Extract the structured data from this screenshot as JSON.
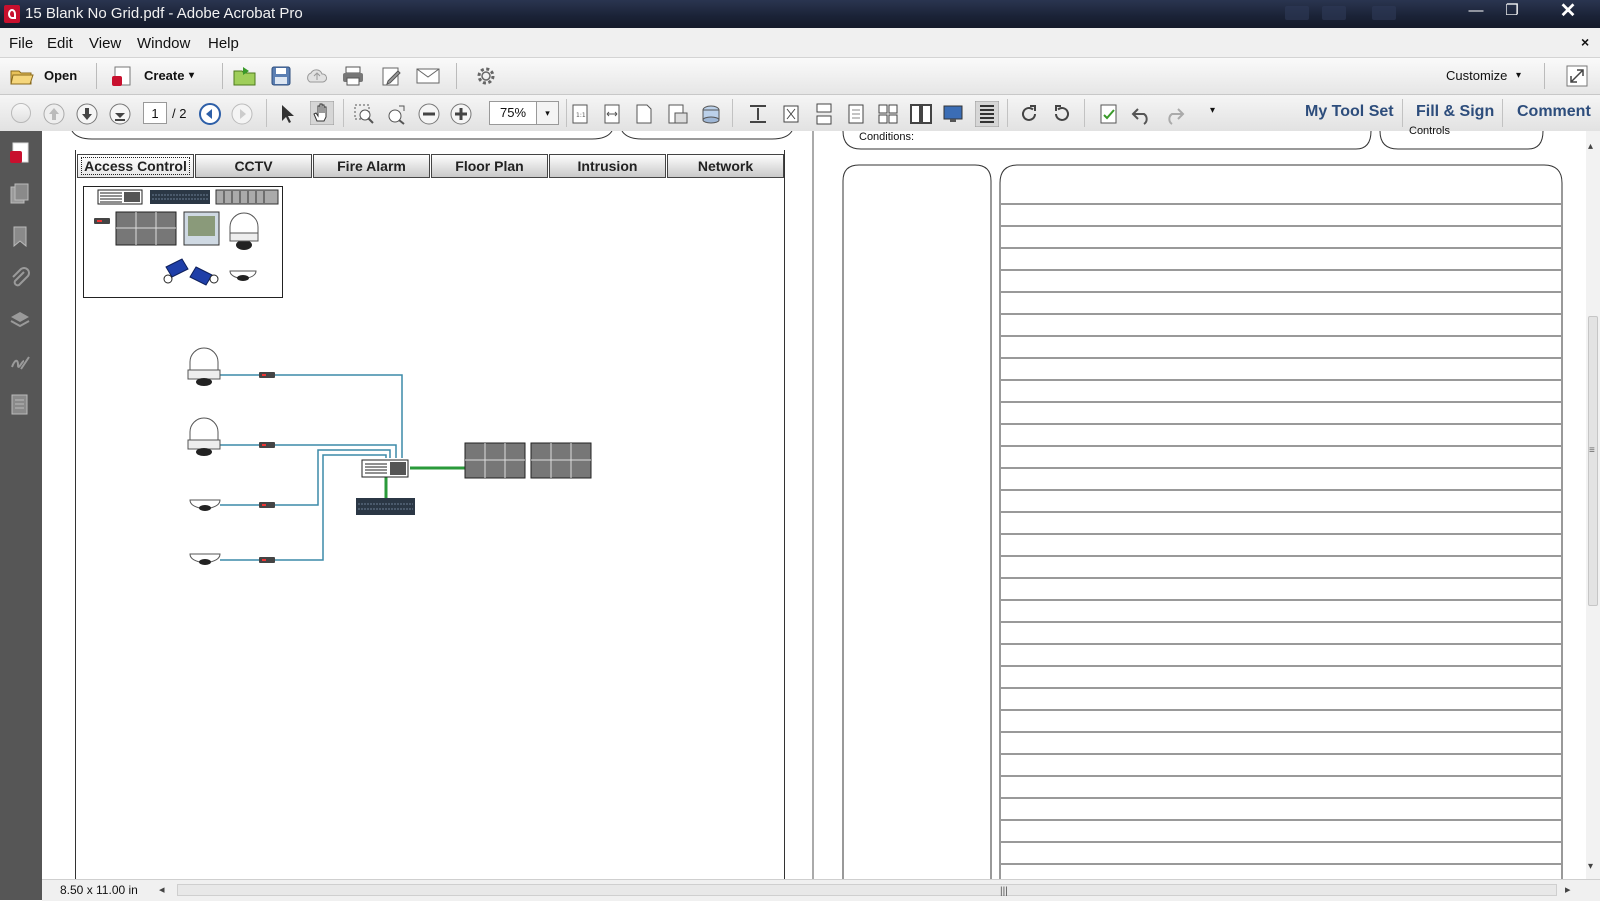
{
  "window": {
    "title": "15 Blank No Grid.pdf - Adobe Acrobat Pro",
    "minimize_glyph": "—",
    "maximize_glyph": "❐",
    "close_glyph": "✕"
  },
  "menubar": {
    "items": [
      "File",
      "Edit",
      "View",
      "Window",
      "Help"
    ],
    "close_glyph": "×"
  },
  "toolbar1": {
    "open_label": "Open",
    "create_label": "Create",
    "create_caret": "▾",
    "customize_label": "Customize",
    "customize_caret": "▾"
  },
  "toolbar2": {
    "page_current": "1",
    "page_total": "/ 2",
    "zoom_value": "75%",
    "zoom_caret": "▾",
    "more_caret": "▾",
    "right_tabs": [
      "My Tool Set",
      "Fill & Sign",
      "Comment"
    ]
  },
  "document": {
    "tabs": [
      "Access Control",
      "CCTV",
      "Fire Alarm",
      "Floor Plan",
      "Intrusion",
      "Network"
    ],
    "active_tab": "Access Control",
    "conditions_label": "Conditions:",
    "controls_label": "Controls",
    "page_size": "8.50 x 11.00 in",
    "hscroll_left": "◂",
    "hscroll_right": "▸",
    "hscroll_grip": "|||",
    "vscroll_up": "▴",
    "vscroll_down": "▾",
    "vscroll_grip": "≡"
  },
  "colors": {
    "link_blue": "#2d4d7c",
    "cable_teal": "#3b8aa8",
    "cable_green": "#2a9a3a",
    "sidebar_gray": "#565656",
    "titlebar_navy": "#1a2236"
  },
  "icons": {
    "sidebar": [
      "pdf-icon",
      "pages-icon",
      "bookmark-icon",
      "attachment-icon",
      "layers-icon",
      "signature-icon",
      "content-icon"
    ]
  }
}
